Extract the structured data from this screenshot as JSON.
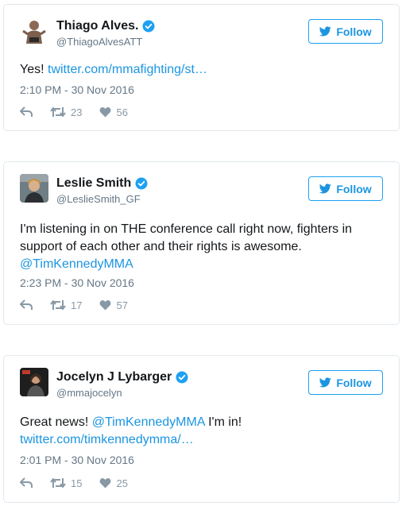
{
  "tweets": [
    {
      "name": "Thiago Alves.",
      "handle": "@ThiagoAlvesATT",
      "follow_label": "Follow",
      "text": "Yes! ",
      "link": "twitter.com/mmafighting/st…",
      "timestamp": "2:10 PM - 30 Nov 2016",
      "retweets": "23",
      "likes": "56"
    },
    {
      "name": "Leslie Smith",
      "handle": "@LeslieSmith_GF",
      "follow_label": "Follow",
      "text": "I'm listening in on THE conference call right now, fighters in support of each other and their rights is awesome.",
      "mention": "@TimKennedyMMA",
      "timestamp": "2:23 PM - 30 Nov 2016",
      "retweets": "17",
      "likes": "57"
    },
    {
      "name": "Jocelyn J Lybarger",
      "handle": "@mmajocelyn",
      "follow_label": "Follow",
      "text": "Great news! ",
      "mention": "@TimKennedyMMA",
      "text_after": " I'm in!",
      "link": "twitter.com/timkennedymma/…",
      "timestamp": "2:01 PM - 30 Nov 2016",
      "retweets": "15",
      "likes": "25"
    }
  ],
  "colors": {
    "accent": "#1b95e0",
    "border": "#e1e8ed",
    "muted": "#657786",
    "icon": "#8899a6"
  },
  "icons": {
    "verified": "verified-badge-icon",
    "bird": "twitter-bird-icon",
    "reply": "reply-icon",
    "retweet": "retweet-icon",
    "like": "heart-icon"
  }
}
